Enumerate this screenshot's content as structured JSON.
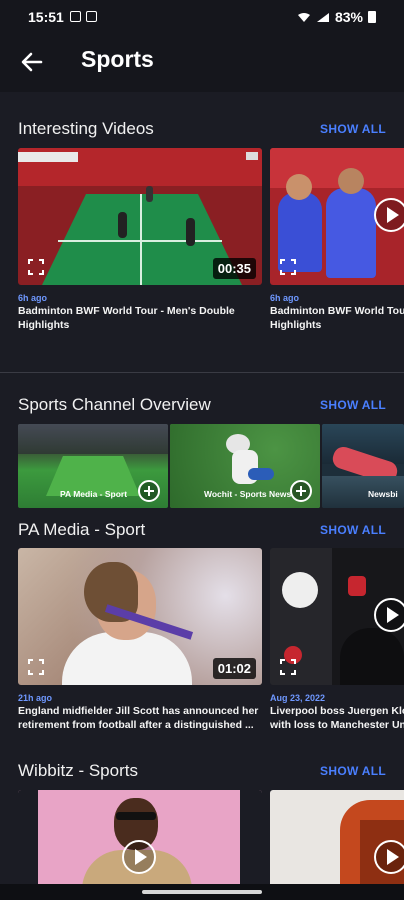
{
  "status": {
    "time": "15:51",
    "battery": "83%"
  },
  "header": {
    "title": "Sports"
  },
  "sections": {
    "interesting": {
      "title": "Interesting Videos",
      "show_all": "SHOW ALL",
      "videos": [
        {
          "age": "6h ago",
          "line1": "Badminton BWF World Tour - Men's Double",
          "line2": "Highlights",
          "duration": "00:35"
        },
        {
          "age": "6h ago",
          "line1": "Badminton BWF World Tour",
          "line2": "Highlights"
        }
      ]
    },
    "channels": {
      "title": "Sports Channel Overview",
      "show_all": "SHOW ALL",
      "items": [
        {
          "label": "PA Media - Sport"
        },
        {
          "label": "Wochit - Sports News"
        },
        {
          "label": "Newsbi"
        }
      ]
    },
    "pa_media": {
      "title": "PA Media - Sport",
      "show_all": "SHOW ALL",
      "videos": [
        {
          "age": "21h ago",
          "line1": "England midfielder Jill Scott has announced her",
          "line2": "retirement from football after a distinguished ...",
          "duration": "01:02"
        },
        {
          "age": "Aug 23, 2022",
          "line1": "Liverpool boss Juergen Klop",
          "line2": "with loss to Manchester Un"
        }
      ]
    },
    "wibbitz": {
      "title": "Wibbitz - Sports",
      "show_all": "SHOW ALL"
    }
  },
  "colors": {
    "accent": "#4a7fff",
    "background": "#1b1c24",
    "header": "#15161c"
  }
}
